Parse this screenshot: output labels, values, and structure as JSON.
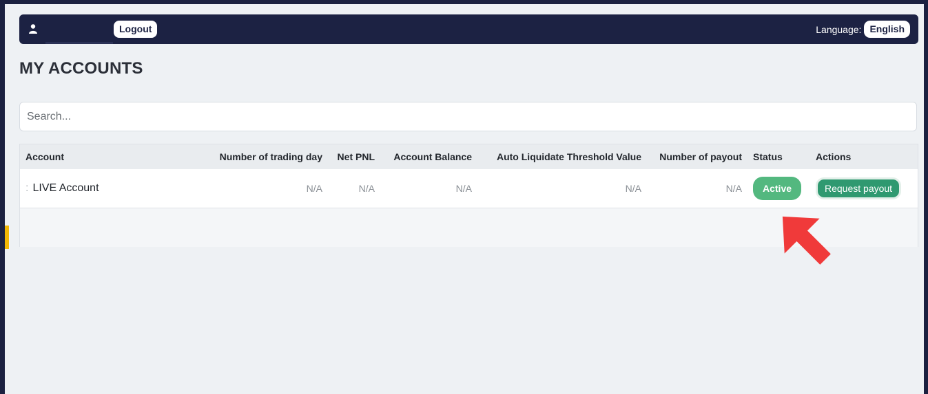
{
  "topbar": {
    "user_icon": "user-icon",
    "logout_label": "Logout",
    "language_label": "Language:",
    "language_value": "English"
  },
  "page": {
    "title": "MY ACCOUNTS"
  },
  "search": {
    "placeholder": "Search..."
  },
  "table": {
    "headers": [
      "Account",
      "Number of trading day",
      "Net PNL",
      "Account Balance",
      "Auto Liquidate Threshold Value",
      "Number of payout",
      "Status",
      "Actions"
    ],
    "rows": [
      {
        "account": "LIVE Account",
        "trading_days": "N/A",
        "net_pnl": "N/A",
        "balance": "N/A",
        "threshold": "N/A",
        "payouts": "N/A",
        "status": "Active",
        "action": "Request payout"
      }
    ]
  },
  "colors": {
    "topbar": "#1c2243",
    "status_active": "#53b87f",
    "action_button": "#2f9970",
    "annotation_arrow": "#f03a3a"
  },
  "annotation": {
    "icon": "arrow-up-right-icon"
  }
}
